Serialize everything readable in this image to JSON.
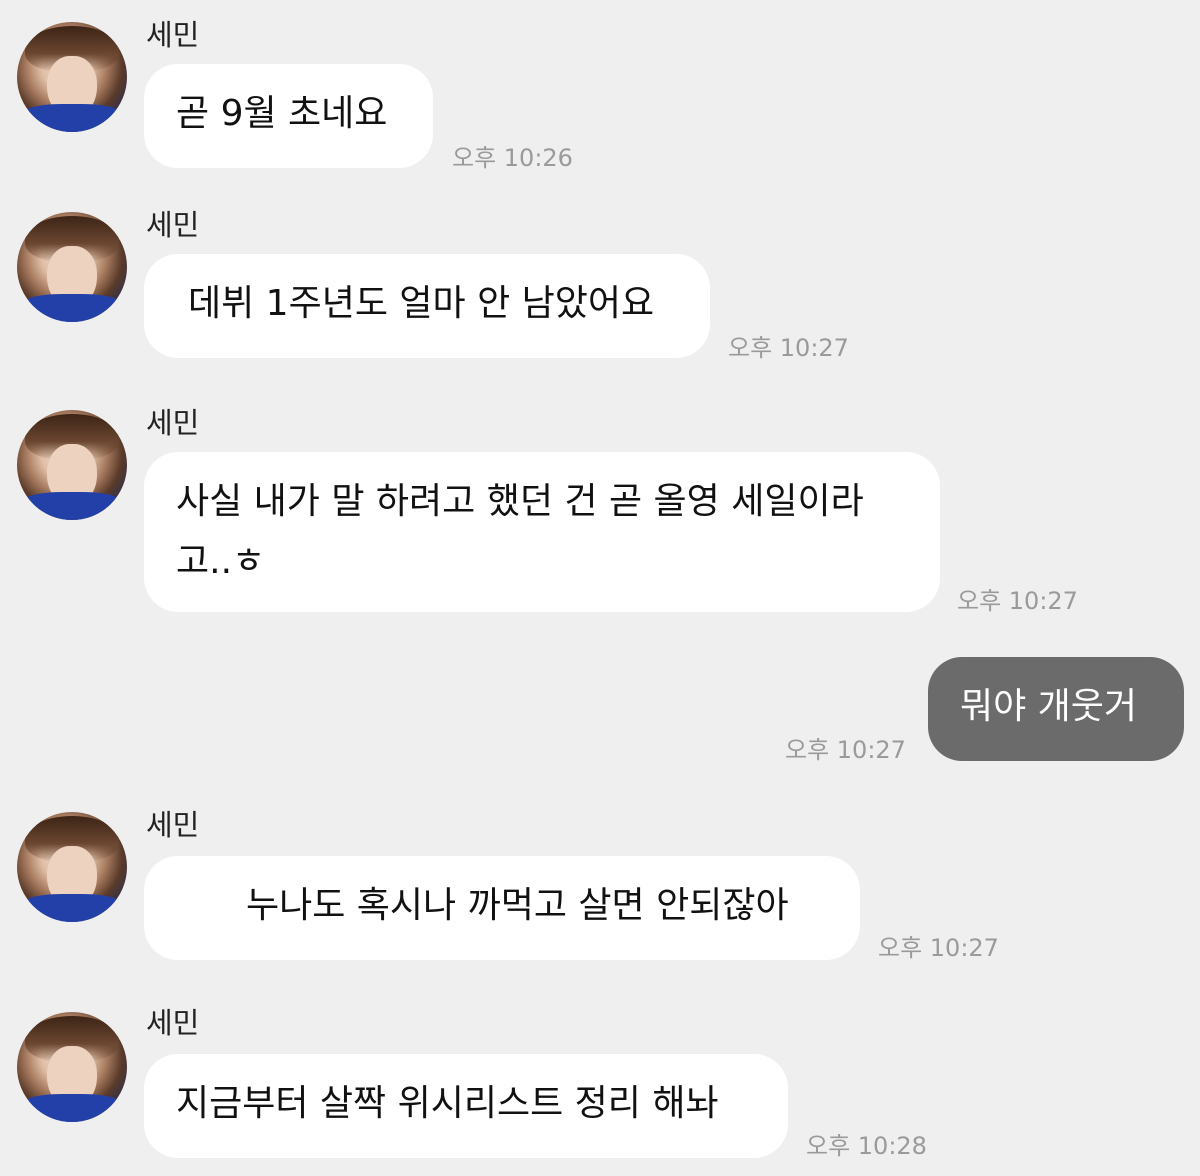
{
  "messages": [
    {
      "sender": "세민",
      "text": "곧 9월 초네요",
      "time": "오후 10:26",
      "mine": false
    },
    {
      "sender": "세민",
      "text": "데뷔 1주년도 얼마 안 남았어요",
      "time": "오후 10:27",
      "mine": false
    },
    {
      "sender": "세민",
      "text": "사실 내가 말 하려고 했던 건 곧 올영 세일이라\n고..ㅎ",
      "time": "오후 10:27",
      "mine": false
    },
    {
      "sender": "",
      "text": "뭐야 개웃거",
      "time": "오후 10:27",
      "mine": true
    },
    {
      "sender": "세민",
      "text": "누나도 혹시나 까먹고 살면 안되잖아",
      "time": "오후 10:27",
      "mine": false
    },
    {
      "sender": "세민",
      "text": "지금부터 살짝 위시리스트 정리 해놔",
      "time": "오후 10:28",
      "mine": false
    }
  ],
  "colors": {
    "background": "#efefef",
    "bubble_in": "#ffffff",
    "bubble_out": "#6b6b6b",
    "time": "#9a9a9a"
  }
}
